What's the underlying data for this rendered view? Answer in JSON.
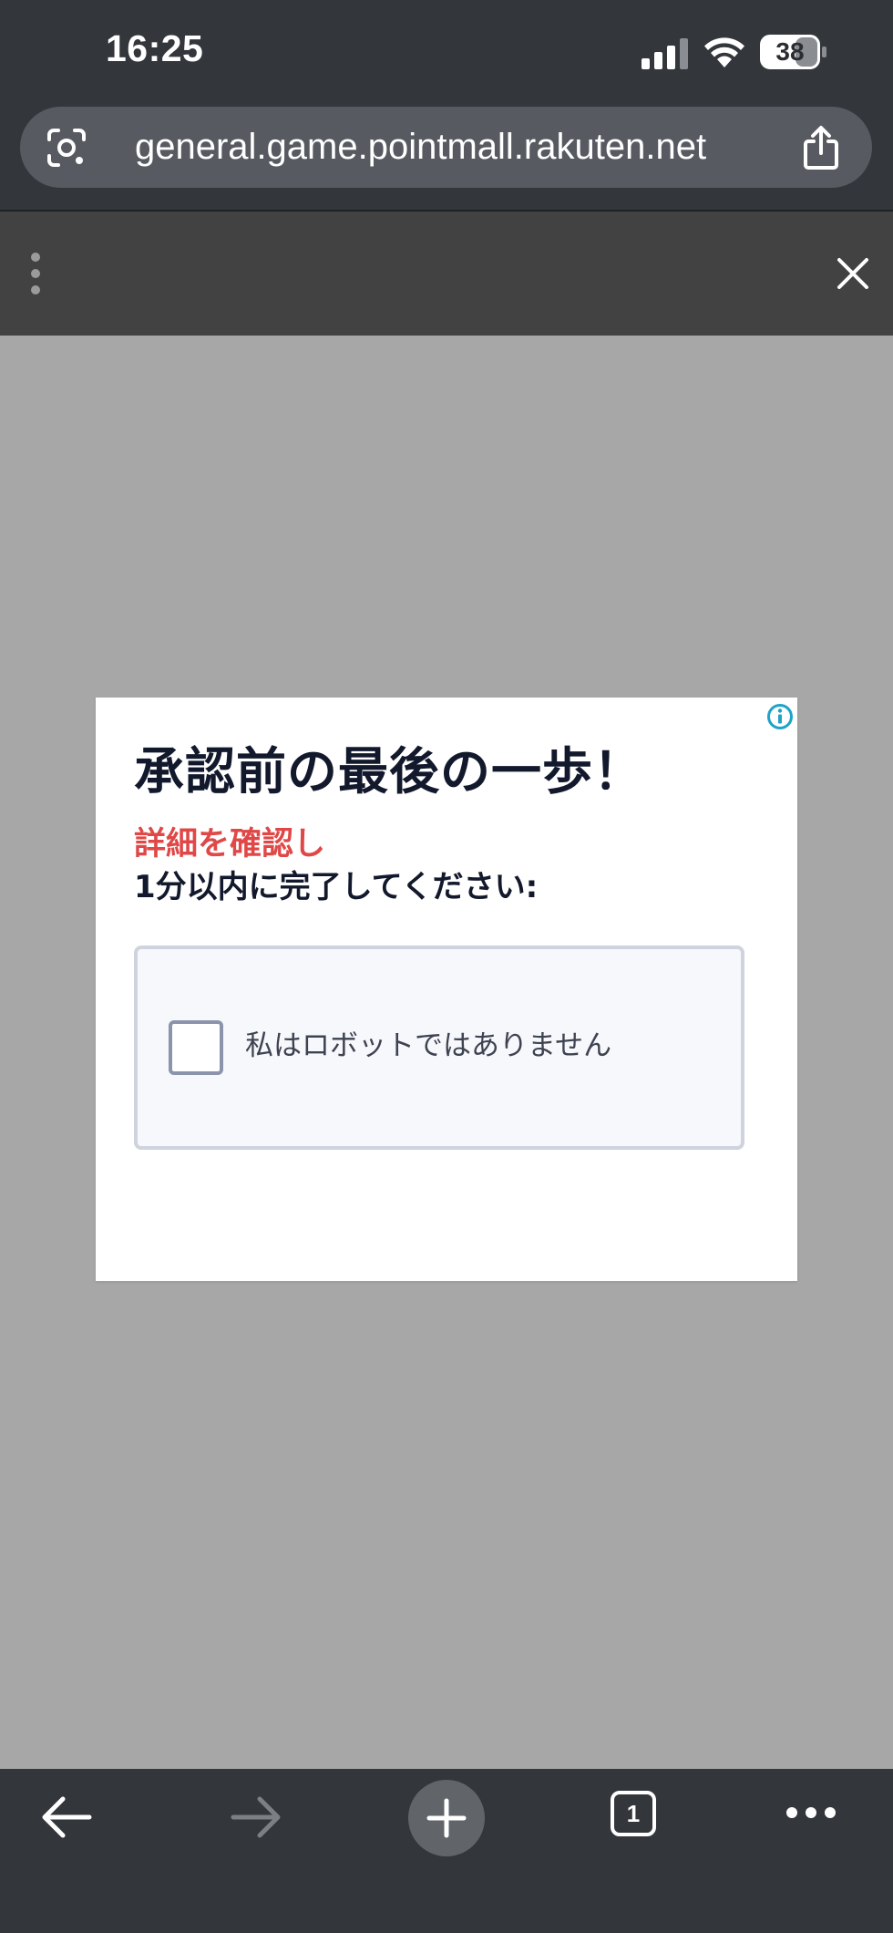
{
  "status_bar": {
    "time": "16:25",
    "battery_level": "38",
    "icons": [
      "signal-icon",
      "wifi-icon",
      "battery-icon"
    ]
  },
  "address_bar": {
    "url": "general.game.pointmall.rakuten.net",
    "icons": [
      "lens-icon",
      "share-icon"
    ]
  },
  "ad_topbar": {
    "icons": [
      "kebab-menu-icon",
      "close-icon"
    ]
  },
  "ad": {
    "title": "承認前の最後の一歩！",
    "subtitle_red": "詳細を確認し",
    "subtitle_dark": "1分以内に完了してください:",
    "captcha": {
      "label": "私はロボットではありません",
      "checked": false
    },
    "icons": [
      "info-icon"
    ]
  },
  "toolbar": {
    "tab_count": "1",
    "icons": [
      "back-arrow-icon",
      "forward-arrow-icon",
      "plus-icon",
      "tab-switcher-icon",
      "more-dots-icon"
    ]
  },
  "colors": {
    "chrome_dark": "#33363b",
    "ad_topbar": "#424242",
    "page_overlay": "#a7a7a7",
    "title_text": "#13192c",
    "accent_red": "#e04848",
    "info_icon": "#1fa3c9"
  }
}
